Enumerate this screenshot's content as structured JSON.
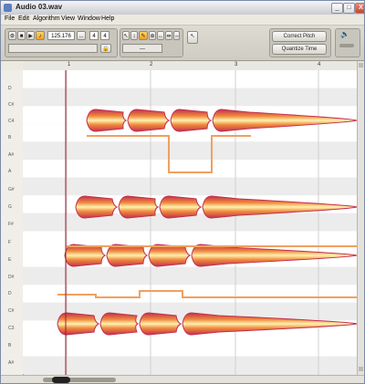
{
  "window": {
    "title": "Audio 03.wav",
    "controls": {
      "minimize": "_",
      "maximize": "□",
      "close": "X"
    }
  },
  "menu": [
    "File",
    "Edit",
    "Algorithm",
    "View",
    "Window",
    "Help"
  ],
  "toolbar": {
    "tempo": "125.176",
    "tempo_more": "...",
    "time_sig_num": "4",
    "time_sig_den": "4",
    "field_value": "---",
    "correct_pitch_label": "Correct Pitch",
    "quantize_time_label": "Quantize Time"
  },
  "ruler": {
    "marks": [
      "1",
      "2",
      "3",
      "4"
    ]
  },
  "keys": [
    "D",
    "C#",
    "C4",
    "B",
    "A#",
    "A",
    "G#",
    "G",
    "F#",
    "F",
    "E",
    "D#",
    "D",
    "C#",
    "C3",
    "B",
    "A#"
  ],
  "colors": {
    "blob_outer": "#c2304f",
    "blob_mid": "#f08a3c",
    "blob_inner": "#fff2b0",
    "pitch_line": "#f0a060",
    "cursor": "#a01830",
    "grid_white": "#ffffff",
    "grid_gray": "#ececec"
  }
}
